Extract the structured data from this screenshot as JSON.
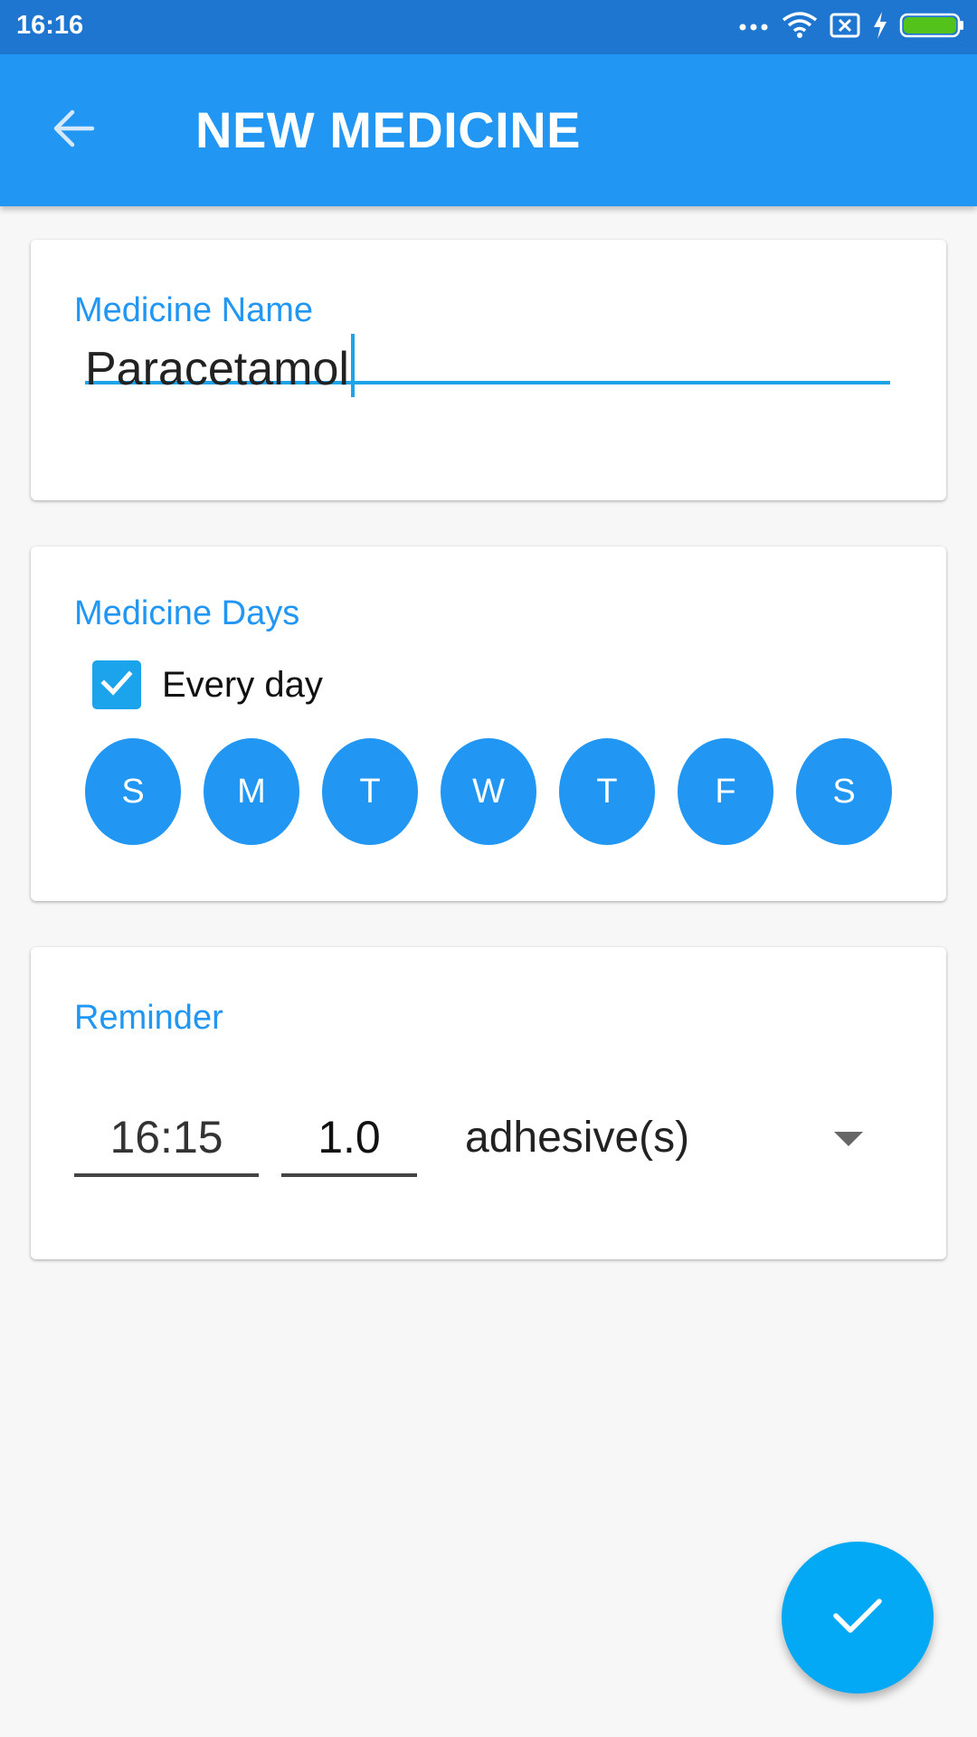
{
  "status_bar": {
    "time": "16:16",
    "icons": [
      "more-dots-icon",
      "wifi-icon",
      "no-sim-icon",
      "charging-icon",
      "battery-icon"
    ],
    "battery_color": "#53c31b"
  },
  "app_bar": {
    "title": "NEW MEDICINE",
    "back_icon": "arrow-back-icon",
    "color": "#2196f3"
  },
  "name_card": {
    "label": "Medicine Name",
    "value": "Paracetamol"
  },
  "days_card": {
    "label": "Medicine Days",
    "every_day_label": "Every day",
    "every_day_checked": true,
    "days": [
      "S",
      "M",
      "T",
      "W",
      "T",
      "F",
      "S"
    ]
  },
  "reminder_card": {
    "label": "Reminder",
    "time": "16:15",
    "quantity": "1.0",
    "unit": "adhesive(s)"
  },
  "fab": {
    "icon": "check-icon",
    "color": "#03a9f4"
  }
}
